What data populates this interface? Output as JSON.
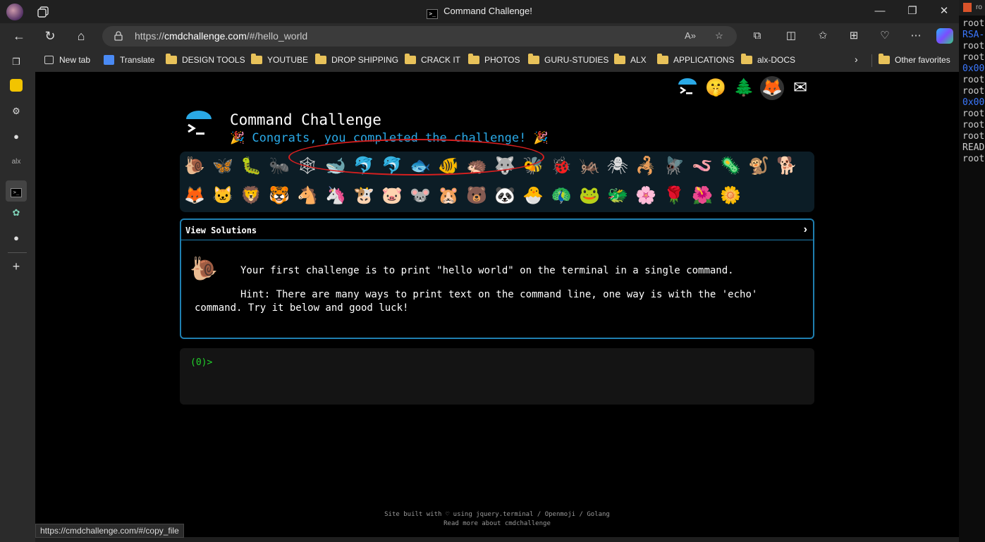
{
  "window": {
    "title": "Command Challenge!"
  },
  "address_bar": {
    "url_prefix": "https://",
    "url_host": "cmdchallenge.com",
    "url_path": "/#/hello_world"
  },
  "favorites": [
    {
      "label": "New tab",
      "icon": "new-tab-icon"
    },
    {
      "label": "Translate",
      "icon": "translate-icon"
    },
    {
      "label": "DESIGN TOOLS",
      "icon": "folder-icon"
    },
    {
      "label": "YOUTUBE",
      "icon": "folder-icon"
    },
    {
      "label": "DROP SHIPPING",
      "icon": "folder-icon"
    },
    {
      "label": "CRACK IT",
      "icon": "folder-icon"
    },
    {
      "label": "PHOTOS",
      "icon": "folder-icon"
    },
    {
      "label": "GURU-STUDIES",
      "icon": "folder-icon"
    },
    {
      "label": "ALX",
      "icon": "folder-icon"
    },
    {
      "label": "APPLICATIONS",
      "icon": "folder-icon"
    },
    {
      "label": "alx-DOCS",
      "icon": "folder-icon"
    },
    {
      "label": "Other favorites",
      "icon": "folder-icon"
    }
  ],
  "sidebar_icons": [
    "tabs-icon",
    "keep-icon",
    "extension-icon",
    "github-icon",
    "alx-icon",
    "terminal-icon",
    "chatgpt-icon",
    "github-icon",
    "add-icon"
  ],
  "sidebar_labels": {
    "alx": "alx"
  },
  "page": {
    "title": "Command Challenge",
    "congrats": "🎉 Congrats, you completed the challenge! 🎉",
    "top_icons": [
      "🐚",
      "🤫",
      "🌲",
      "🦊",
      "✉"
    ],
    "animals_row1": [
      "🐌",
      "🦋",
      "🐛",
      "🐜",
      "🕸",
      "🐋",
      "🐬",
      "🐬",
      "🐟",
      "🐠",
      "🦔",
      "🐺",
      "🐝",
      "🐞",
      "🦗",
      "🕷",
      "🦂",
      "🪰",
      "🪱",
      "🦠",
      "🐒",
      "🐕"
    ],
    "animals_row2": [
      "🦊",
      "🐱",
      "🦁",
      "🐯",
      "🐴",
      "🦄",
      "🐮",
      "🐷",
      "🐭",
      "🐹",
      "🐻",
      "🐼",
      "🐣",
      "🦚",
      "🐸",
      "🐲",
      "🌸",
      "🌹",
      "🌺",
      "🌼"
    ],
    "solutions_label": "View Solutions",
    "challenge_text": "Your first challenge is to print \"hello world\" on the terminal in a single command.",
    "hint_text": "Hint: There are many ways to print text on the command line, one way is with the 'echo' command. Try it below and good luck!",
    "prompt": "(0)>",
    "footer_line1": "Site built with ♡ using jquery.terminal / Openmoji / Golang",
    "footer_line2": "Read more about cmdchallenge"
  },
  "status_bar": {
    "hover_url": "https://cmdchallenge.com/#/copy_file"
  },
  "right_terminal": {
    "title": "ro",
    "lines": [
      {
        "text": "root",
        "color": "#cccccc"
      },
      {
        "text": "RSA-",
        "color": "#3b78ff"
      },
      {
        "text": "root",
        "color": "#cccccc"
      },
      {
        "text": "root",
        "color": "#cccccc"
      },
      {
        "text": "0x00",
        "color": "#3b78ff"
      },
      {
        "text": "root",
        "color": "#cccccc"
      },
      {
        "text": "root",
        "color": "#cccccc"
      },
      {
        "text": "0x00",
        "color": "#3b78ff"
      },
      {
        "text": "root",
        "color": "#cccccc"
      },
      {
        "text": "root",
        "color": "#cccccc"
      },
      {
        "text": "root",
        "color": "#cccccc"
      },
      {
        "text": "READ",
        "color": "#cccccc"
      },
      {
        "text": "root",
        "color": "#cccccc"
      }
    ]
  },
  "colors": {
    "accent": "#2aa9e6",
    "prompt_green": "#22d22b",
    "highlight_red": "#d61f1f",
    "panel_border": "#1f7fb0"
  }
}
